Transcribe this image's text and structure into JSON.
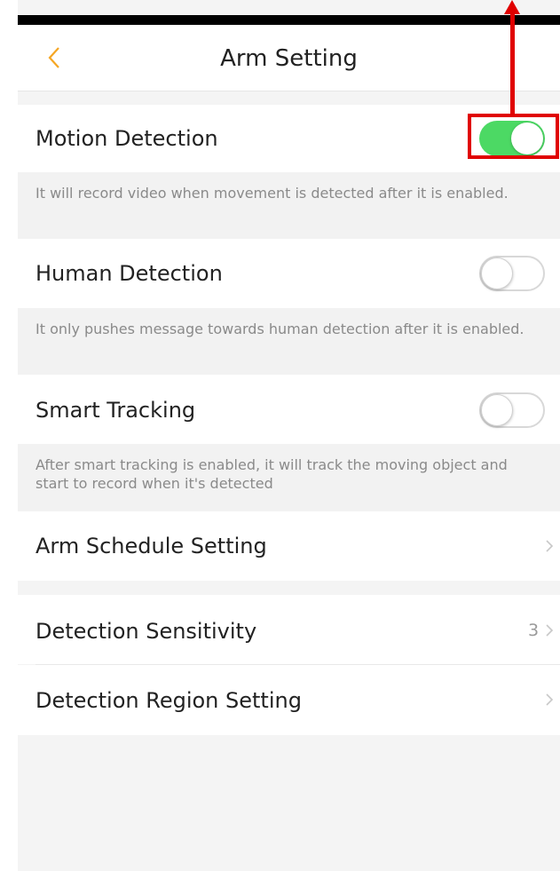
{
  "header": {
    "title": "Arm Setting"
  },
  "settings": {
    "motion": {
      "label": "Motion Detection",
      "enabled": true,
      "description": "It will record video when movement is detected after it is enabled."
    },
    "human": {
      "label": "Human Detection",
      "enabled": false,
      "description": "It only pushes message towards human detection after it is enabled."
    },
    "tracking": {
      "label": "Smart Tracking",
      "enabled": false,
      "description": "After smart tracking is enabled, it will track the moving object and start to record when it's detected"
    },
    "schedule": {
      "label": "Arm Schedule Setting"
    },
    "sensitivity": {
      "label": "Detection Sensitivity",
      "value": "3"
    },
    "region": {
      "label": "Detection Region Setting"
    }
  },
  "colors": {
    "accent": "#f5a623",
    "toggle_on": "#4cd964",
    "annotation": "#e00000"
  },
  "icons": {
    "back": "chevron-left-icon",
    "row_arrow": "chevron-right-icon"
  }
}
